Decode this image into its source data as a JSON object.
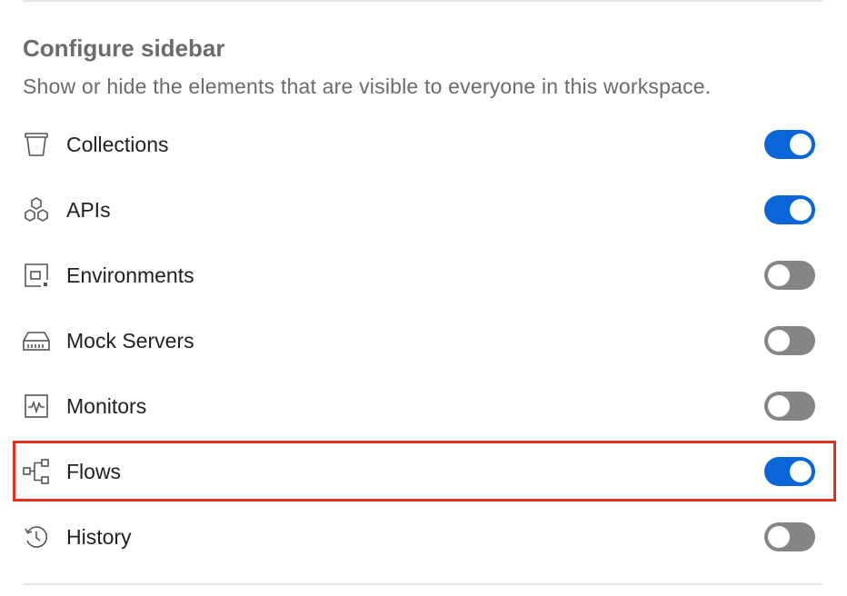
{
  "section": {
    "title": "Configure sidebar",
    "description": "Show or hide the elements that are visible to everyone in this workspace."
  },
  "items": [
    {
      "label": "Collections",
      "icon": "collections-icon",
      "enabled": true
    },
    {
      "label": "APIs",
      "icon": "apis-icon",
      "enabled": true
    },
    {
      "label": "Environments",
      "icon": "environments-icon",
      "enabled": false
    },
    {
      "label": "Mock Servers",
      "icon": "mock-servers-icon",
      "enabled": false
    },
    {
      "label": "Monitors",
      "icon": "monitors-icon",
      "enabled": false
    },
    {
      "label": "Flows",
      "icon": "flows-icon",
      "enabled": true,
      "highlighted": true
    },
    {
      "label": "History",
      "icon": "history-icon",
      "enabled": false
    }
  ],
  "colors": {
    "toggle_on": "#0a66d8",
    "toggle_off": "#858585",
    "highlight_border": "#e0311d"
  }
}
